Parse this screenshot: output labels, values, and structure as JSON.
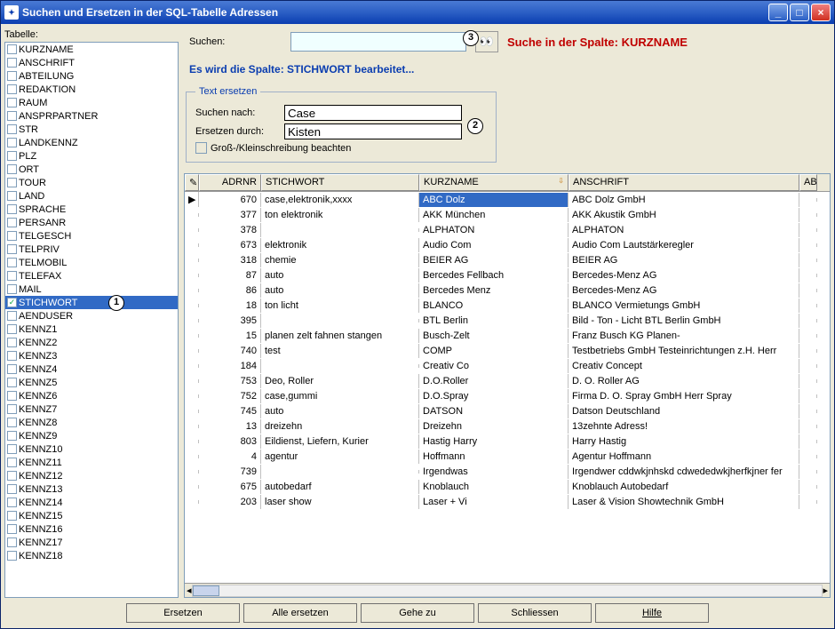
{
  "window": {
    "title": "Suchen und Ersetzen in der SQL-Tabelle Adressen"
  },
  "sidebar": {
    "label": "Tabelle:",
    "selected_index": 21,
    "items": [
      "KURZNAME",
      "ANSCHRIFT",
      "ABTEILUNG",
      "REDAKTION",
      "RAUM",
      "ANSPRPARTNER",
      "STR",
      "LANDKENNZ",
      "PLZ",
      "ORT",
      "TOUR",
      "LAND",
      "SPRACHE",
      "PERSANR",
      "TELGESCH",
      "TELPRIV",
      "TELMOBIL",
      "TELEFAX",
      "MAIL",
      "STICHWORT",
      "AENDUSER",
      "KENNZ1",
      "KENNZ2",
      "KENNZ3",
      "KENNZ4",
      "KENNZ5",
      "KENNZ6",
      "KENNZ7",
      "KENNZ8",
      "KENNZ9",
      "KENNZ10",
      "KENNZ11",
      "KENNZ12",
      "KENNZ13",
      "KENNZ14",
      "KENNZ15",
      "KENNZ16",
      "KENNZ17",
      "KENNZ18"
    ]
  },
  "search": {
    "label": "Suchen:",
    "value": "",
    "column_label": "Suche in der Spalte: KURZNAME",
    "info_line": "Es wird die Spalte: STICHWORT bearbeitet..."
  },
  "replace_group": {
    "legend": "Text ersetzen",
    "search_label": "Suchen nach:",
    "search_value": "Case",
    "replace_label": "Ersetzen durch:",
    "replace_value": "Kisten",
    "case_label": "Groß-/Kleinschreibung beachten",
    "case_checked": false
  },
  "grid": {
    "columns": [
      "ADRNR",
      "STICHWORT",
      "KURZNAME",
      "ANSCHRIFT",
      "AB"
    ],
    "sort_column": 2,
    "selected_row": 0,
    "rows": [
      {
        "adrnr": 670,
        "stichwort": "case,elektronik,xxxx",
        "kurzname": "ABC Dolz",
        "anschrift": "ABC Dolz GmbH"
      },
      {
        "adrnr": 377,
        "stichwort": "ton elektronik",
        "kurzname": "AKK München",
        "anschrift": "AKK Akustik GmbH"
      },
      {
        "adrnr": 378,
        "stichwort": "",
        "kurzname": "ALPHATON",
        "anschrift": "ALPHATON"
      },
      {
        "adrnr": 673,
        "stichwort": "elektronik",
        "kurzname": "Audio Com",
        "anschrift": "Audio Com Lautstärkeregler"
      },
      {
        "adrnr": 318,
        "stichwort": "chemie",
        "kurzname": "BEIER AG",
        "anschrift": "BEIER AG"
      },
      {
        "adrnr": 87,
        "stichwort": "auto",
        "kurzname": "Bercedes Fellbach",
        "anschrift": "Bercedes-Menz AG"
      },
      {
        "adrnr": 86,
        "stichwort": "auto",
        "kurzname": "Bercedes Menz",
        "anschrift": "Bercedes-Menz AG"
      },
      {
        "adrnr": 18,
        "stichwort": "ton licht",
        "kurzname": "BLANCO",
        "anschrift": "BLANCO Vermietungs GmbH"
      },
      {
        "adrnr": 395,
        "stichwort": "",
        "kurzname": "BTL Berlin",
        "anschrift": "Bild - Ton - Licht BTL Berlin GmbH"
      },
      {
        "adrnr": 15,
        "stichwort": "planen zelt fahnen stangen",
        "kurzname": "Busch-Zelt",
        "anschrift": "Franz Busch KG Planen-"
      },
      {
        "adrnr": 740,
        "stichwort": "test",
        "kurzname": "COMP",
        "anschrift": "Testbetriebs GmbH Testeinrichtungen z.H. Herr"
      },
      {
        "adrnr": 184,
        "stichwort": "",
        "kurzname": "Creativ Co",
        "anschrift": "Creativ Concept"
      },
      {
        "adrnr": 753,
        "stichwort": "Deo, Roller",
        "kurzname": "D.O.Roller",
        "anschrift": "D. O. Roller AG"
      },
      {
        "adrnr": 752,
        "stichwort": "case,gummi",
        "kurzname": "D.O.Spray",
        "anschrift": "Firma D. O. Spray GmbH Herr Spray"
      },
      {
        "adrnr": 745,
        "stichwort": "auto",
        "kurzname": "DATSON",
        "anschrift": "Datson Deutschland"
      },
      {
        "adrnr": 13,
        "stichwort": "dreizehn",
        "kurzname": "Dreizehn",
        "anschrift": "13zehnte Adress!"
      },
      {
        "adrnr": 803,
        "stichwort": "Eildienst, Liefern, Kurier",
        "kurzname": "Hastig Harry",
        "anschrift": "Harry Hastig"
      },
      {
        "adrnr": 4,
        "stichwort": "agentur",
        "kurzname": "Hoffmann",
        "anschrift": "Agentur Hoffmann"
      },
      {
        "adrnr": 739,
        "stichwort": "",
        "kurzname": "Irgendwas",
        "anschrift": "Irgendwer cddwkjnhskd cdwededwkjherfkjner fer"
      },
      {
        "adrnr": 675,
        "stichwort": "autobedarf",
        "kurzname": "Knoblauch",
        "anschrift": "Knoblauch Autobedarf"
      },
      {
        "adrnr": 203,
        "stichwort": "laser show",
        "kurzname": "Laser + Vi",
        "anschrift": "Laser & Vision Showtechnik GmbH"
      }
    ]
  },
  "buttons": {
    "replace": "Ersetzen",
    "replace_all": "Alle ersetzen",
    "goto": "Gehe zu",
    "close": "Schliessen",
    "help": "Hilfe"
  },
  "callouts": {
    "c1": "1",
    "c2": "2",
    "c3": "3"
  }
}
